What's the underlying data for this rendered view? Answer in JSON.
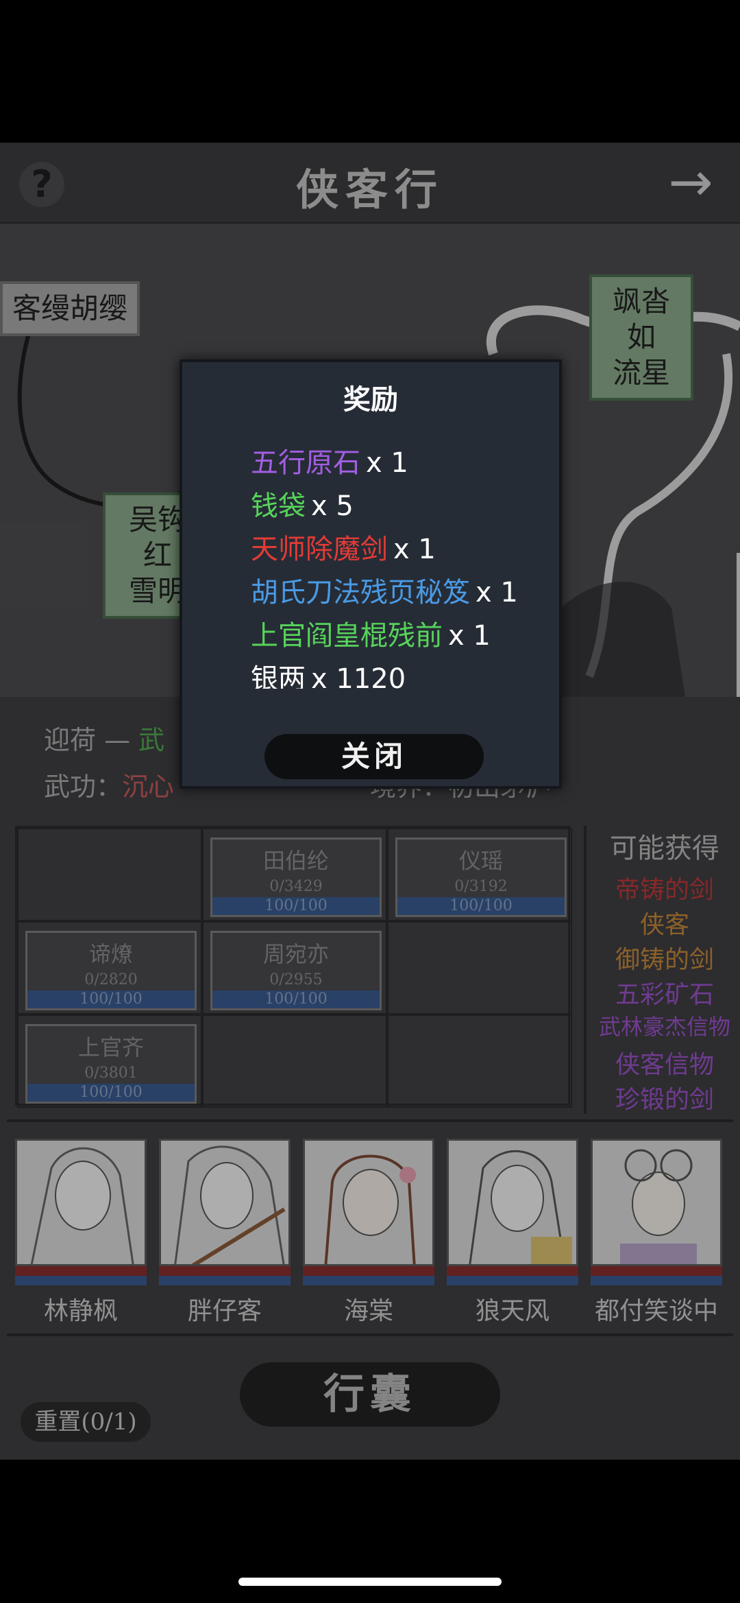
{
  "header": {
    "title": "侠客行",
    "help_icon": "?",
    "arrow_icon": "→"
  },
  "map": {
    "signs": [
      {
        "text": "客缦胡缨",
        "style": "grey"
      },
      {
        "text": "飒沓如\n流星",
        "style": "green"
      },
      {
        "text": "吴钩红\n雪明",
        "style": "green"
      }
    ]
  },
  "info": {
    "line1_prefix": "迎荷 — ",
    "line1_value": "武",
    "line2_prefix": "武功：",
    "line2_value": "沉心",
    "line2_right": "境界：初出茅庐"
  },
  "enemies": [
    {
      "name": "田伯纶",
      "count": "0/3429",
      "hp": "100/100"
    },
    {
      "name": "仪瑶",
      "count": "0/3192",
      "hp": "100/100"
    },
    {
      "name": "谛燎",
      "count": "0/2820",
      "hp": "100/100"
    },
    {
      "name": "周宛亦",
      "count": "0/2955",
      "hp": "100/100"
    },
    {
      "name": "上官齐",
      "count": "0/3801",
      "hp": "100/100"
    }
  ],
  "obtain": {
    "title": "可能获得",
    "items": [
      {
        "label": "帝铸的剑",
        "color": "#b93a3a"
      },
      {
        "label": "侠客",
        "color": "#c1873a"
      },
      {
        "label": "御铸的剑",
        "color": "#c1873a"
      },
      {
        "label": "五彩矿石",
        "color": "#9a52c9"
      },
      {
        "label": "武林豪杰信物",
        "color": "#9a52c9"
      },
      {
        "label": "侠客信物",
        "color": "#9a52c9"
      },
      {
        "label": "珍锻的剑",
        "color": "#9a52c9"
      }
    ]
  },
  "heroes": [
    {
      "name": "林静枫"
    },
    {
      "name": "胖仔客"
    },
    {
      "name": "海棠"
    },
    {
      "name": "狼天风"
    },
    {
      "name": "都付笑谈中"
    }
  ],
  "bottom": {
    "bag_label": "行囊",
    "reset_label": "重置(0/1)"
  },
  "dialog": {
    "title": "奖励",
    "rewards": [
      {
        "name": "五行原石",
        "qty": "x 1",
        "color": "#a35ee3"
      },
      {
        "name": "钱袋",
        "qty": "x 5",
        "color": "#57d45a"
      },
      {
        "name": "天师除魔剑",
        "qty": "x 1",
        "color": "#e33b35"
      },
      {
        "name": "胡氏刀法残页秘笈",
        "qty": "x 1",
        "color": "#4a9be6"
      },
      {
        "name": "上官阎皇棍残前",
        "qty": "x 1",
        "color": "#57d45a"
      },
      {
        "name": "银两",
        "qty": "x 1120",
        "color": "#ffffff"
      }
    ],
    "close_label": "关闭"
  }
}
